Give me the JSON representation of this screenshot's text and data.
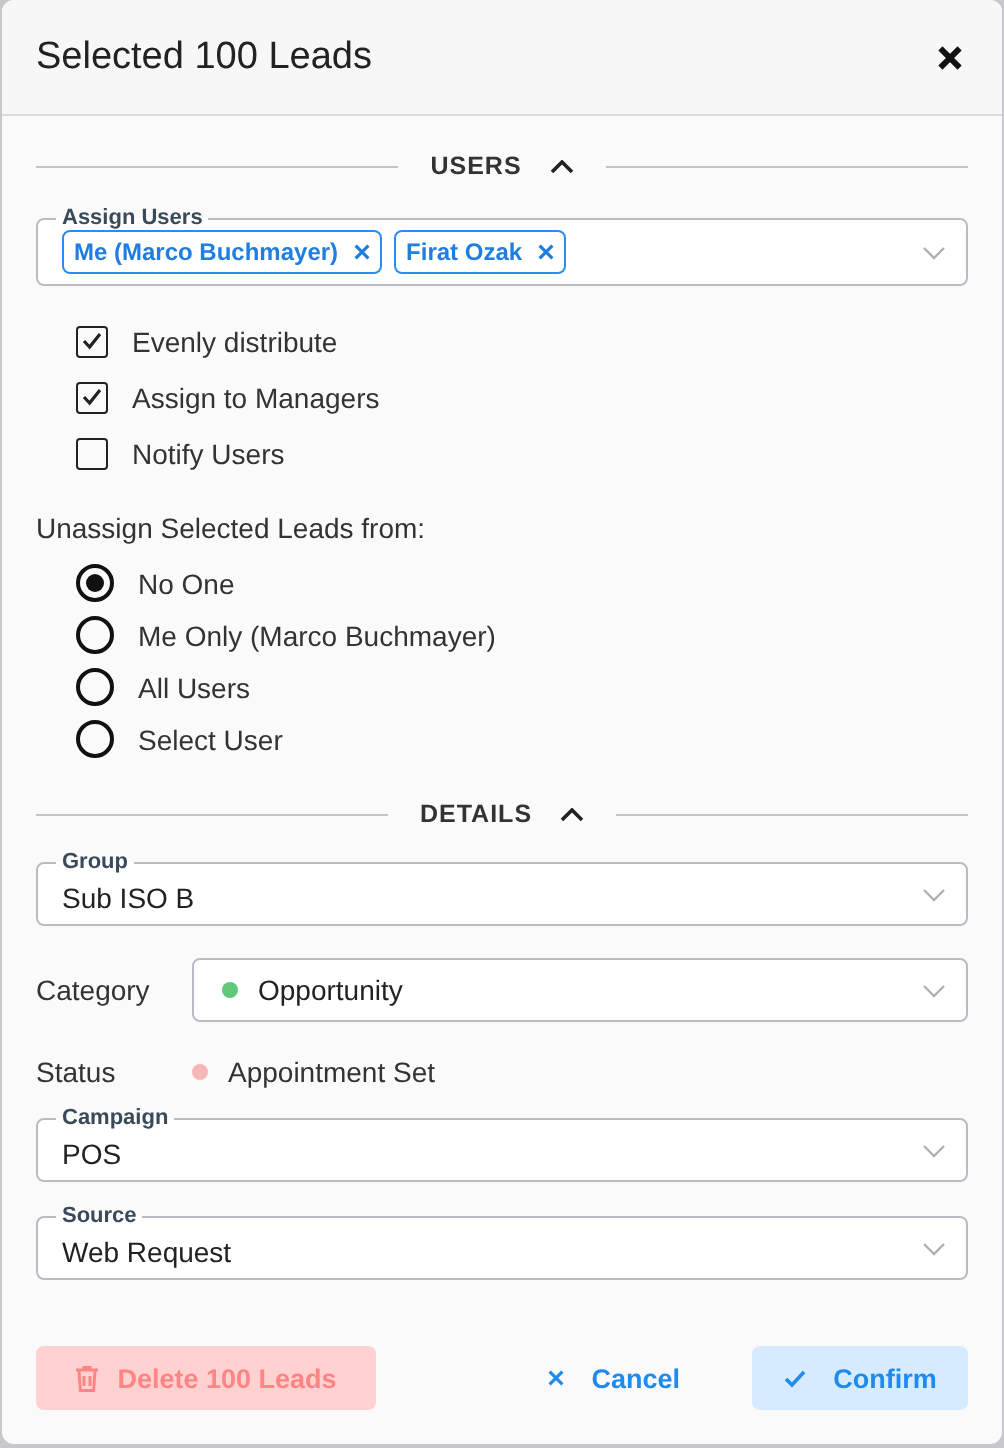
{
  "dialog": {
    "title": "Selected 100 Leads"
  },
  "users_section": {
    "title": "USERS",
    "expanded": true
  },
  "assign_users": {
    "label": "Assign Users",
    "chips": [
      "Me (Marco Buchmayer)",
      "Firat Ozak"
    ]
  },
  "options": [
    {
      "label": "Evenly distribute",
      "checked": true
    },
    {
      "label": "Assign to Managers",
      "checked": true
    },
    {
      "label": "Notify Users",
      "checked": false
    }
  ],
  "unassign": {
    "label": "Unassign Selected Leads from:",
    "choices": [
      {
        "label": "No One",
        "selected": true
      },
      {
        "label": "Me Only (Marco Buchmayer)",
        "selected": false
      },
      {
        "label": "All Users",
        "selected": false
      },
      {
        "label": "Select User",
        "selected": false
      }
    ]
  },
  "details_section": {
    "title": "DETAILS",
    "expanded": true
  },
  "group": {
    "label": "Group",
    "value": "Sub ISO B"
  },
  "category": {
    "label": "Category",
    "value": "Opportunity",
    "color": "#5ec97a"
  },
  "status": {
    "label": "Status",
    "value": "Appointment Set",
    "color": "#f7b7b7"
  },
  "campaign": {
    "label": "Campaign",
    "value": "POS"
  },
  "source": {
    "label": "Source",
    "value": "Web Request"
  },
  "buttons": {
    "delete": "Delete 100 Leads",
    "cancel": "Cancel",
    "confirm": "Confirm"
  }
}
